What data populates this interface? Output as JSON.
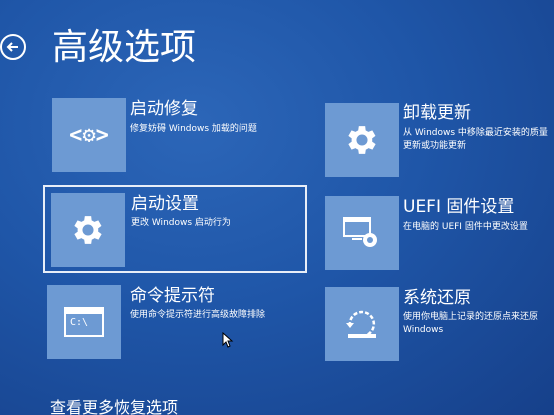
{
  "page": {
    "title": "高级选项",
    "more_link": "查看更多恢复选项"
  },
  "options": [
    {
      "id": "startup-repair",
      "title": "启动修复",
      "desc": "修复妨碍 Windows 加载的问题",
      "icon": "code-brackets-gear-icon"
    },
    {
      "id": "uninstall-updates",
      "title": "卸载更新",
      "desc": "从 Windows 中移除最近安装的质量更新或功能更新",
      "icon": "gear-icon"
    },
    {
      "id": "startup-settings",
      "title": "启动设置",
      "desc": "更改 Windows 启动行为",
      "icon": "gear-icon",
      "selected": true
    },
    {
      "id": "uefi-settings",
      "title": "UEFI 固件设置",
      "desc": "在电脑的 UEFI 固件中更改设置",
      "icon": "monitor-gear-icon"
    },
    {
      "id": "command-prompt",
      "title": "命令提示符",
      "desc": "使用命令提示符进行高级故障排除",
      "icon": "command-prompt-icon",
      "prompt_text": "C:\\"
    },
    {
      "id": "system-restore",
      "title": "系统还原",
      "desc": "使用你电脑上记录的还原点来还原 Windows",
      "icon": "system-restore-icon"
    }
  ],
  "colors": {
    "background": "#1f4e9d",
    "tile": "#6d9ad3",
    "text": "#ffffff"
  }
}
